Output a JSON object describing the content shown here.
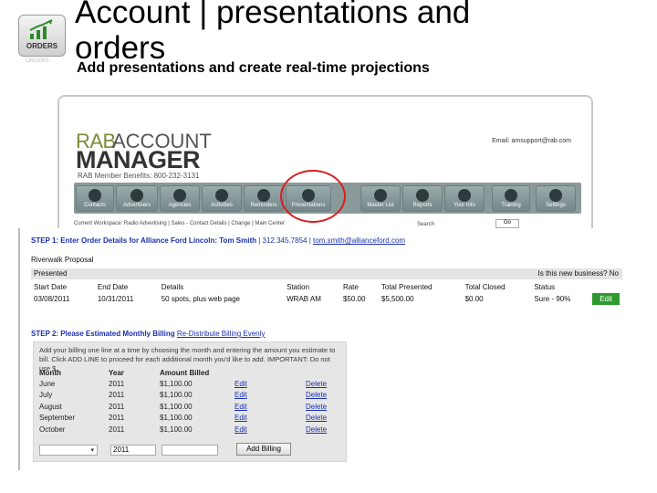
{
  "slide": {
    "title": "Account | presentations and orders",
    "subtitle": "Add presentations and create real-time projections",
    "logo_text": "ORDERS"
  },
  "ram": {
    "brand_rab": "RAB",
    "brand_account": "ACCOUNT",
    "brand_manager": "MANAGER",
    "member_line": "RAB Member Benefits: 800-232-3131",
    "email": "Email: amsupport@rab.com",
    "toolbar": [
      {
        "label": "Contacts",
        "icon": "contacts-icon"
      },
      {
        "label": "Advertisers",
        "icon": "advertisers-icon"
      },
      {
        "label": "Agencies",
        "icon": "agencies-icon"
      },
      {
        "label": "Activities",
        "icon": "activities-icon"
      },
      {
        "label": "Reminders",
        "icon": "reminders-icon"
      },
      {
        "label": "Presentations",
        "icon": "presentations-icon"
      },
      {
        "label": "Master List",
        "icon": "master-list-icon"
      },
      {
        "label": "Reports",
        "icon": "reports-icon"
      },
      {
        "label": "Your Info",
        "icon": "your-info-icon"
      },
      {
        "label": "Training",
        "icon": "training-icon"
      },
      {
        "label": "Settings",
        "icon": "settings-icon"
      }
    ],
    "strip_text": "Current Workspace: Radio Advertising | Sales - Contact Details | Change | Main Center",
    "search_label": "Search",
    "go_label": "Go",
    "accent_color": "#d91e1e"
  },
  "order": {
    "step1_label": "STEP 1: Enter Order Details for Alliance Ford Lincoln: Tom Smith",
    "step1_phone": "| 312.345.7854 |",
    "step1_email": "tom.smith@allianceford.com",
    "proposal_title": "Riverwalk Proposal",
    "presented_label": "Presented",
    "new_business_q": "Is this new business? No",
    "columns": [
      "Start Date",
      "End Date",
      "Details",
      "Station",
      "Rate",
      "Total Presented",
      "Total Closed",
      "Status"
    ],
    "row": {
      "start": "03/08/2011",
      "end": "10/31/2011",
      "details": "50 spots, plus web page",
      "station": "WRAB AM",
      "rate": "$50.00",
      "total_presented": "$5,500.00",
      "total_closed": "$0.00",
      "status": "Sure - 90%",
      "edit": "Edit"
    },
    "step2_label": "STEP 2: Please Estimated Monthly Billing",
    "step2_link": "Re-Distribute Billing Evenly",
    "instructions": "Add your billing one line at a time by choosing the month and entering the amount you estimate to bill. Click ADD LINE to proceed for each additional month you'd like to add. IMPORTANT: Do not use $.",
    "billing_columns": [
      "Month",
      "Year",
      "Amount Billed"
    ],
    "billing_rows": [
      {
        "month": "June",
        "year": "2011",
        "amount": "$1,100.00",
        "edit": "Edit",
        "delete": "Delete"
      },
      {
        "month": "July",
        "year": "2011",
        "amount": "$1,100.00",
        "edit": "Edit",
        "delete": "Delete"
      },
      {
        "month": "August",
        "year": "2011",
        "amount": "$1,100.00",
        "edit": "Edit",
        "delete": "Delete"
      },
      {
        "month": "September",
        "year": "2011",
        "amount": "$1,100.00",
        "edit": "Edit",
        "delete": "Delete"
      },
      {
        "month": "October",
        "year": "2011",
        "amount": "$1,100.00",
        "edit": "Edit",
        "delete": "Delete"
      }
    ],
    "new_year_value": "2011",
    "add_billing_label": "Add Billing"
  }
}
